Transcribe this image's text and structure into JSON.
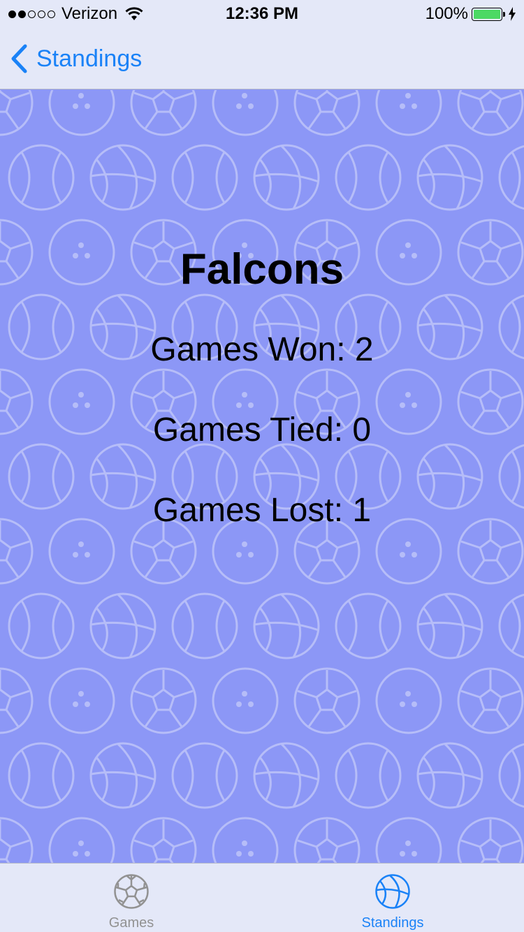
{
  "status_bar": {
    "carrier": "Verizon",
    "time": "12:36 PM",
    "battery": "100%",
    "signal_bars": 2,
    "signal_total": 5
  },
  "nav": {
    "back_label": "Standings",
    "back_icon": "chevron-left-icon"
  },
  "team": {
    "name": "Falcons",
    "won": "Games Won: 2",
    "tied": "Games Tied: 0",
    "lost": "Games Lost: 1"
  },
  "tab_bar": {
    "tabs": [
      {
        "label": "Games",
        "icon": "soccer-ball-icon",
        "selected": false
      },
      {
        "label": "Standings",
        "icon": "basketball-icon",
        "selected": true
      }
    ]
  },
  "colors": {
    "accent": "#1a82f7",
    "background": "#8c97f6",
    "bar": "#e4e8f8",
    "battery": "#4cd964",
    "inactive": "#929292"
  }
}
